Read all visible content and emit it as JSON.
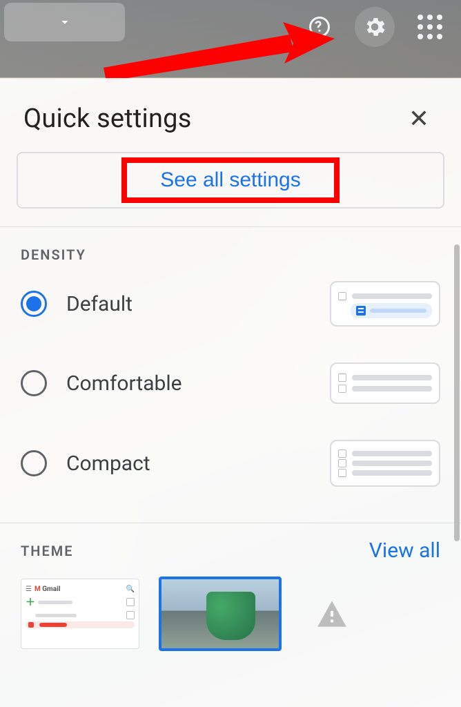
{
  "panel": {
    "title": "Quick settings",
    "see_all_label": "See all settings"
  },
  "density": {
    "section_label": "DENSITY",
    "options": [
      {
        "label": "Default",
        "selected": true
      },
      {
        "label": "Comfortable",
        "selected": false
      },
      {
        "label": "Compact",
        "selected": false
      }
    ]
  },
  "theme": {
    "section_label": "THEME",
    "view_all_label": "View all",
    "thumbs": [
      {
        "name": "default-gmail",
        "selected": false
      },
      {
        "name": "photo-theme",
        "selected": true
      },
      {
        "name": "placeholder",
        "selected": false
      }
    ]
  },
  "icons": {
    "help": "help-icon",
    "gear": "gear-icon",
    "apps": "apps-grid-icon",
    "close": "close-icon",
    "dropdown": "caret-down-icon",
    "warning": "warning-icon"
  },
  "colors": {
    "accent": "#1a73e8",
    "highlight_red": "#ff0000"
  }
}
